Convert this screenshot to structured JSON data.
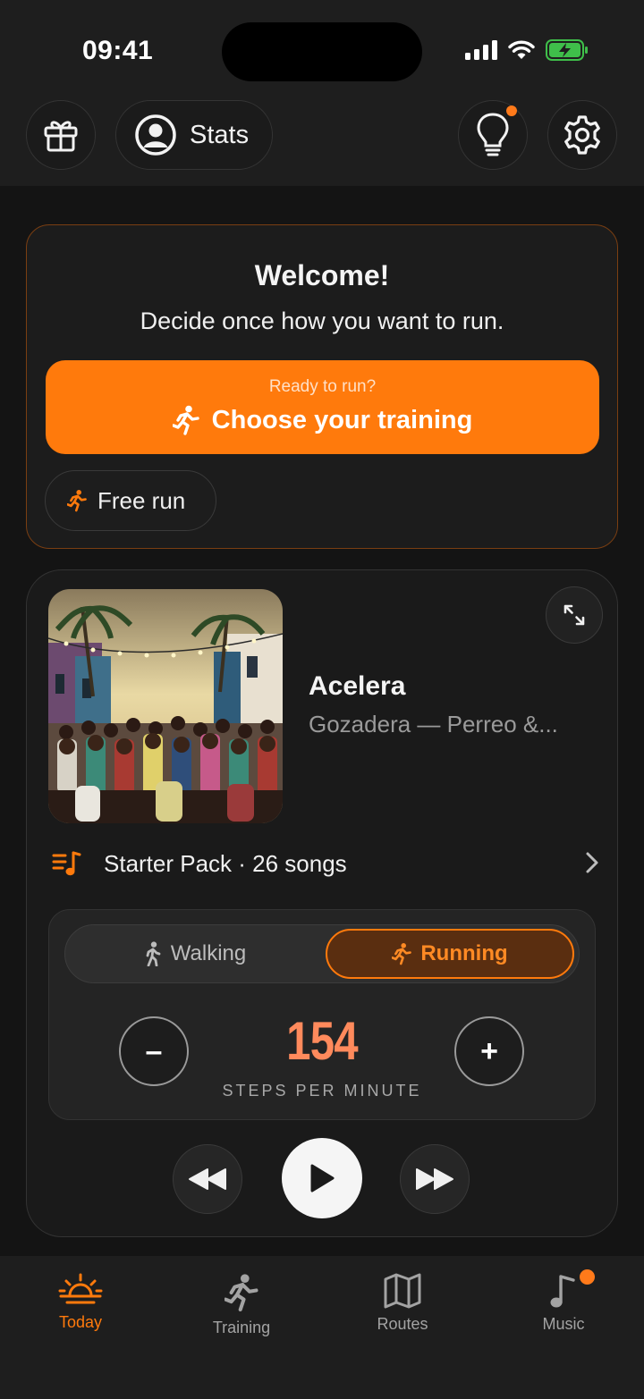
{
  "status_bar": {
    "time": "09:41"
  },
  "header": {
    "gift_icon": "gift-icon",
    "stats_label": "Stats",
    "tips_icon": "lightbulb-icon",
    "settings_icon": "gear-icon"
  },
  "welcome": {
    "title": "Welcome!",
    "subtitle": "Decide once how you want to run.",
    "cta_small": "Ready to run?",
    "cta_main": "Choose your training",
    "free_run": "Free run"
  },
  "player": {
    "song_title": "Acelera",
    "song_artist": "Gozadera — Perreo &...",
    "playlist": "Starter Pack · 26 songs",
    "mode_walking": "Walking",
    "mode_running": "Running",
    "selected_mode": "Running",
    "spm_value": "154",
    "spm_label": "STEPS PER MINUTE",
    "minus_label": "–",
    "plus_label": "+"
  },
  "tabs": [
    {
      "label": "Today",
      "icon": "sunrise-icon",
      "active": true
    },
    {
      "label": "Training",
      "icon": "runner-icon",
      "active": false
    },
    {
      "label": "Routes",
      "icon": "map-icon",
      "active": false
    },
    {
      "label": "Music",
      "icon": "music-note-icon",
      "active": false
    }
  ],
  "colors": {
    "accent": "#ff7a0c",
    "background": "#141414",
    "surface": "#1e1e1e"
  }
}
